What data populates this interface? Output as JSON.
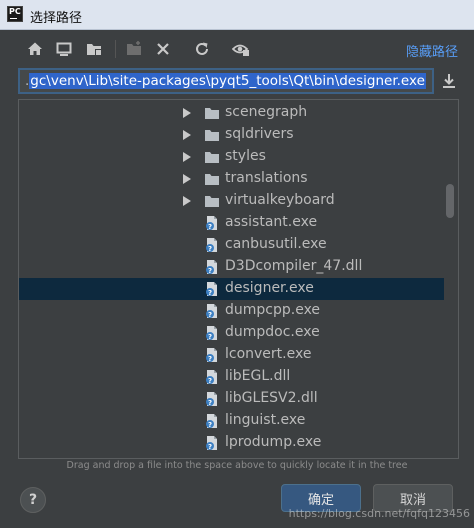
{
  "window": {
    "title": "选择路径",
    "app_icon": "pycharm-logo"
  },
  "toolbar": {
    "icons": [
      "home-icon",
      "desktop-icon",
      "project-icon",
      "new-folder-icon",
      "delete-icon",
      "refresh-icon",
      "show-hidden-icon"
    ],
    "hide_path_label": "隐藏路径"
  },
  "path": {
    "prefix": ".",
    "selected_text": "gc\\venv\\Lib\\site-packages\\pyqt5_tools\\Qt\\bin\\designer.exe"
  },
  "tree": {
    "items": [
      {
        "label": "scenegraph",
        "type": "folder",
        "expandable": true
      },
      {
        "label": "sqldrivers",
        "type": "folder",
        "expandable": true
      },
      {
        "label": "styles",
        "type": "folder",
        "expandable": true
      },
      {
        "label": "translations",
        "type": "folder",
        "expandable": true
      },
      {
        "label": "virtualkeyboard",
        "type": "folder",
        "expandable": true
      },
      {
        "label": "assistant.exe",
        "type": "file"
      },
      {
        "label": "canbusutil.exe",
        "type": "file"
      },
      {
        "label": "D3Dcompiler_47.dll",
        "type": "file"
      },
      {
        "label": "designer.exe",
        "type": "file",
        "selected": true
      },
      {
        "label": "dumpcpp.exe",
        "type": "file"
      },
      {
        "label": "dumpdoc.exe",
        "type": "file"
      },
      {
        "label": "lconvert.exe",
        "type": "file"
      },
      {
        "label": "libEGL.dll",
        "type": "file"
      },
      {
        "label": "libGLESV2.dll",
        "type": "file"
      },
      {
        "label": "linguist.exe",
        "type": "file"
      },
      {
        "label": "lprodump.exe",
        "type": "file"
      }
    ]
  },
  "hint": "Drag and drop a file into the space above to quickly locate it in the tree",
  "buttons": {
    "help": "?",
    "ok": "确定",
    "cancel": "取消"
  },
  "watermark": "https://blog.csdn.net/fqfq123456",
  "colors": {
    "accent": "#589df6",
    "selection": "#0d293e",
    "primary_button": "#365880",
    "background": "#3c3f41"
  }
}
